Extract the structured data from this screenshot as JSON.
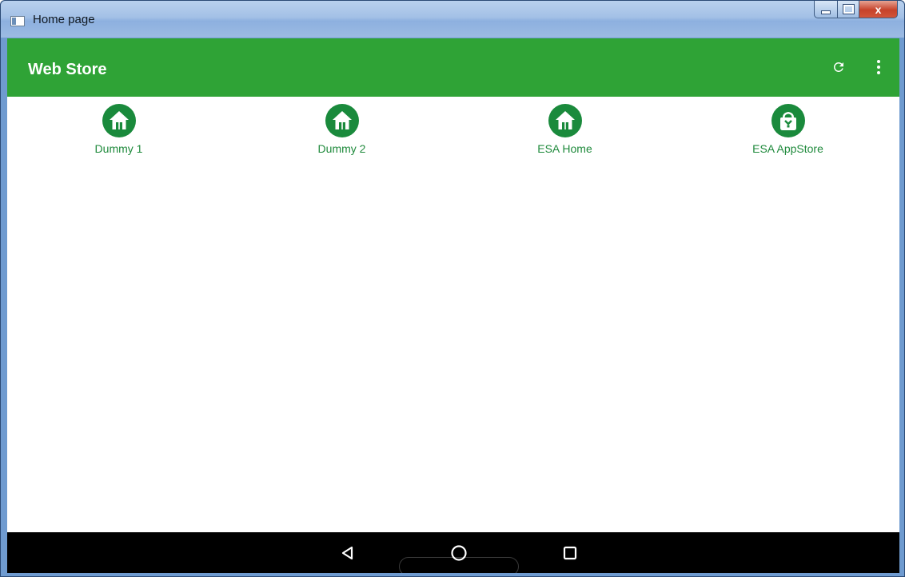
{
  "window": {
    "title": "Home page",
    "controls": {
      "minimize": "minimize",
      "maximize": "maximize",
      "close": "x"
    }
  },
  "appbar": {
    "title": "Web Store",
    "background": "#2fa336",
    "actions": [
      {
        "name": "refresh-icon"
      },
      {
        "name": "more-vert-icon"
      }
    ]
  },
  "apps": [
    {
      "label": "Dummy 1",
      "icon": "home-icon"
    },
    {
      "label": "Dummy 2",
      "icon": "home-icon"
    },
    {
      "label": "ESA Home",
      "icon": "home-icon"
    },
    {
      "label": "ESA AppStore",
      "icon": "shopping-bag-icon"
    }
  ],
  "accent_color": "#1a8a3c",
  "navbar": {
    "buttons": [
      {
        "name": "back-icon"
      },
      {
        "name": "home-icon"
      },
      {
        "name": "recents-icon"
      }
    ]
  }
}
